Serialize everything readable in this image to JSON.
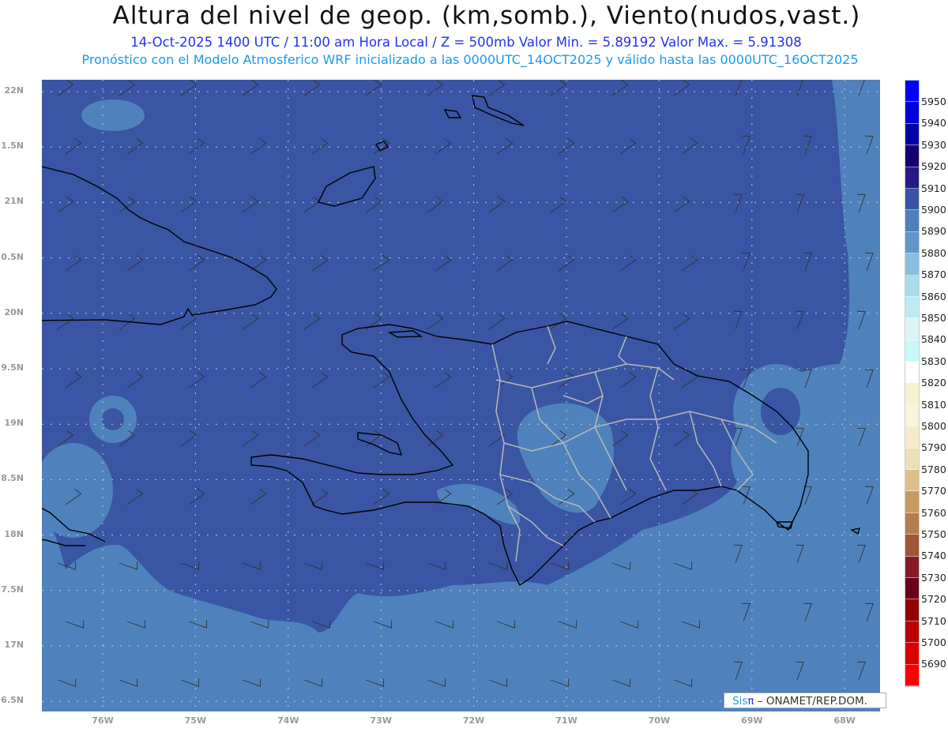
{
  "title": "Altura del nivel de geop. (km,somb.), Viento(nudos,vast.)",
  "subtitle": "14-Oct-2025  1400 UTC / 11:00 am Hora Local / Z = 500mb   Valor Min. = 5.89192  Valor Max. = 5.91308",
  "model_line": "Pronóstico con el Modelo Atmosferico WRF inicializado a las 0000UTC_14OCT2025 y válido hasta las  0000UTC_16OCT2025",
  "lat_labels": [
    "22N",
    "1.5N",
    "21N",
    "0.5N",
    "20N",
    "9.5N",
    "19N",
    "8.5N",
    "18N",
    "7.5N",
    "17N",
    "6.5N"
  ],
  "lon_labels": [
    "76W",
    "75W",
    "74W",
    "73W",
    "72W",
    "71W",
    "70W",
    "69W",
    "68W"
  ],
  "colorbar": {
    "labels": [
      "5950",
      "5940",
      "5930",
      "5920",
      "5910",
      "5900",
      "5890",
      "5880",
      "5870",
      "5860",
      "5850",
      "5840",
      "5830",
      "5820",
      "5810",
      "5800",
      "5790",
      "5780",
      "5770",
      "5760",
      "5750",
      "5740",
      "5730",
      "5720",
      "5710",
      "5700",
      "5690"
    ],
    "colors": [
      "#0000ff",
      "#0000dd",
      "#0000a8",
      "#13006e",
      "#241c83",
      "#3a54a3",
      "#4f80bc",
      "#5f97c8",
      "#8bbedd",
      "#a8dcea",
      "#bdeaf2",
      "#dcf4f8",
      "#c8f8f8",
      "#ffffff",
      "#f7f1cf",
      "#f9f3e0",
      "#f6eacb",
      "#eddfb5",
      "#dcc08c",
      "#c79a62",
      "#b47d4e",
      "#9e5639",
      "#861a26",
      "#6b0019",
      "#930000",
      "#bb0000",
      "#dd0000",
      "#ff0000"
    ]
  },
  "colors": {
    "dark": "#3a55a4",
    "light": "#4f82bd"
  },
  "logo": {
    "sis": "Sis",
    "pi": "π",
    "rest": "–  ONAMET/REP.DOM."
  }
}
